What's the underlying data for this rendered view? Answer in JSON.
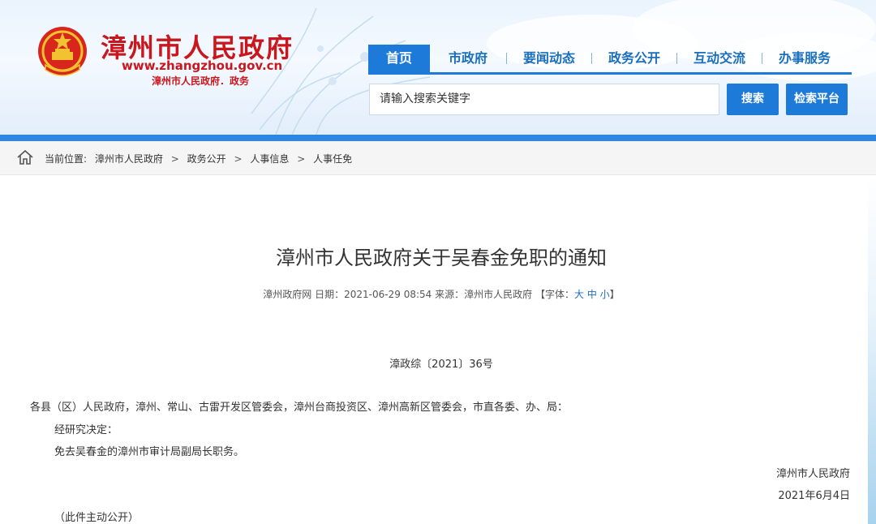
{
  "header": {
    "site_title": "漳州市人民政府",
    "site_url": "www.zhangzhou.gov.cn",
    "site_subtitle": "漳州市人民政府．政务"
  },
  "nav": {
    "items": [
      {
        "label": "首页",
        "active": true
      },
      {
        "label": "市政府",
        "active": false
      },
      {
        "label": "要闻动态",
        "active": false
      },
      {
        "label": "政务公开",
        "active": false
      },
      {
        "label": "互动交流",
        "active": false
      },
      {
        "label": "办事服务",
        "active": false
      }
    ]
  },
  "search": {
    "placeholder": "请输入搜索关键字",
    "search_label": "搜索",
    "platform_label": "检索平台"
  },
  "breadcrumb": {
    "prefix": "当前位置:",
    "items": [
      "漳州市人民政府",
      "政务公开",
      "人事信息",
      "人事任免"
    ],
    "separator": ">"
  },
  "article": {
    "title": "漳州市人民政府关于吴春金免职的通知",
    "meta": {
      "source_site": "漳州政府网",
      "date_label": "日期：",
      "date": "2021-06-29 08:54",
      "source_label": "来源：",
      "source": "漳州市人民政府",
      "font_label": "【字体：",
      "font_large": "大",
      "font_medium": "中",
      "font_small": "小",
      "font_close": "】"
    },
    "doc_number": "漳政综〔2021〕36号",
    "recipients": "各县（区）人民政府，漳州、常山、古雷开发区管委会，漳州台商投资区、漳州高新区管委会，市直各委、办、局：",
    "decision_intro": "经研究决定：",
    "decision": "免去吴春金的漳州市审计局副局长职务。",
    "signature": "漳州市人民政府",
    "signed_date": "2021年6月4日",
    "disclosure": "（此件主动公开）"
  },
  "colors": {
    "brand_red": "#c9171e",
    "nav_blue": "#1d7ad8",
    "link_blue": "#1a6fbd"
  }
}
